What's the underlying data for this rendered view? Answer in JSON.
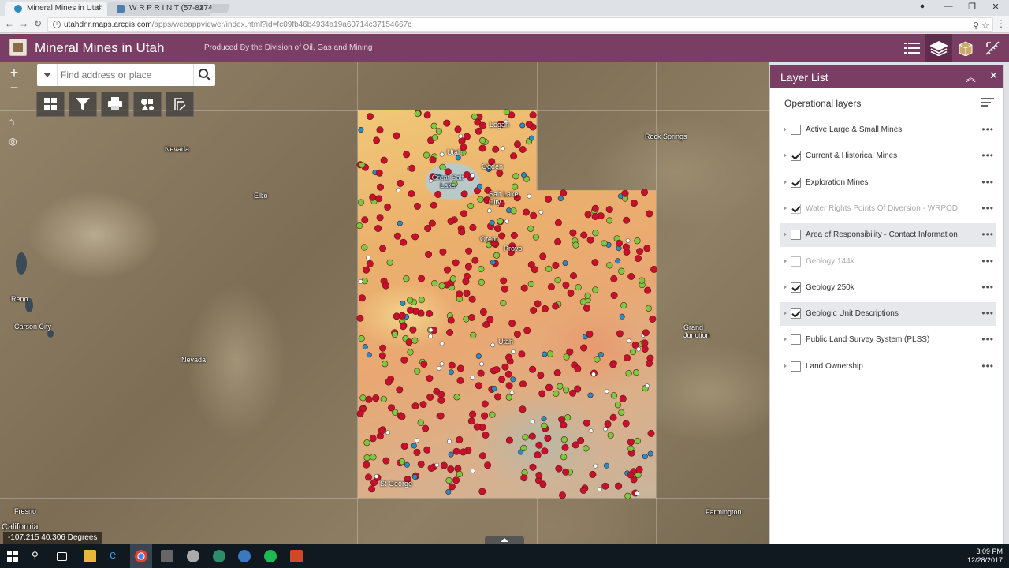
{
  "browser": {
    "tabs": [
      {
        "title": "Mineral Mines in Utah",
        "favicon_color": "#2e8bc0"
      },
      {
        "title": "W R P R I N T (57-8274)",
        "favicon_color": "#4a7fb0"
      }
    ],
    "url_host": "utahdnr.maps.arcgis.com",
    "url_path": "/apps/webappviewer/index.html?id=fc09fb46b4934a19a60714c37154667c"
  },
  "app": {
    "title": "Mineral Mines in Utah",
    "subtitle": "Produced By the Division of Oil, Gas and Mining"
  },
  "search": {
    "placeholder": "Find address or place"
  },
  "map": {
    "places": [
      {
        "name": "Nevada"
      },
      {
        "name": "Elko"
      },
      {
        "name": "Reno"
      },
      {
        "name": "Carson City"
      },
      {
        "name": "Nevada"
      },
      {
        "name": "Fresno"
      },
      {
        "name": "California"
      },
      {
        "name": "Rock Springs"
      },
      {
        "name": "Grand Junction"
      },
      {
        "name": "Farmington"
      },
      {
        "name": "Logan"
      },
      {
        "name": "Utah"
      },
      {
        "name": "Ogden"
      },
      {
        "name": "Great Salt Lake"
      },
      {
        "name": "Salt Lake City"
      },
      {
        "name": "Orem"
      },
      {
        "name": "Provo"
      },
      {
        "name": "Utah"
      },
      {
        "name": "St George"
      }
    ],
    "coordinates": "-107.215 40.306 Degrees",
    "marker_colors": {
      "mines": "#c8102e",
      "exploration": "#7ac943",
      "water": "#1f8fd0"
    }
  },
  "layer_list": {
    "title": "Layer List",
    "section": "Operational layers",
    "layers": [
      {
        "name": "Active Large & Small Mines",
        "checked": false,
        "dim": false
      },
      {
        "name": "Current & Historical Mines",
        "checked": true,
        "dim": false
      },
      {
        "name": "Exploration Mines",
        "checked": true,
        "dim": false
      },
      {
        "name": "Water Rights Points Of Diversion - WRPOD",
        "checked": true,
        "dim": true
      },
      {
        "name": "Area of Responsibility - Contact Information",
        "checked": false,
        "dim": false
      },
      {
        "name": "Geology 144k",
        "checked": false,
        "dim": true
      },
      {
        "name": "Geology 250k",
        "checked": true,
        "dim": false
      },
      {
        "name": "Geologic Unit Descriptions",
        "checked": true,
        "dim": false
      },
      {
        "name": "Public Land Survey System (PLSS)",
        "checked": false,
        "dim": false
      },
      {
        "name": "Land Ownership",
        "checked": false,
        "dim": false
      }
    ]
  },
  "taskbar": {
    "time": "3:09 PM",
    "date": "12/28/2017"
  }
}
